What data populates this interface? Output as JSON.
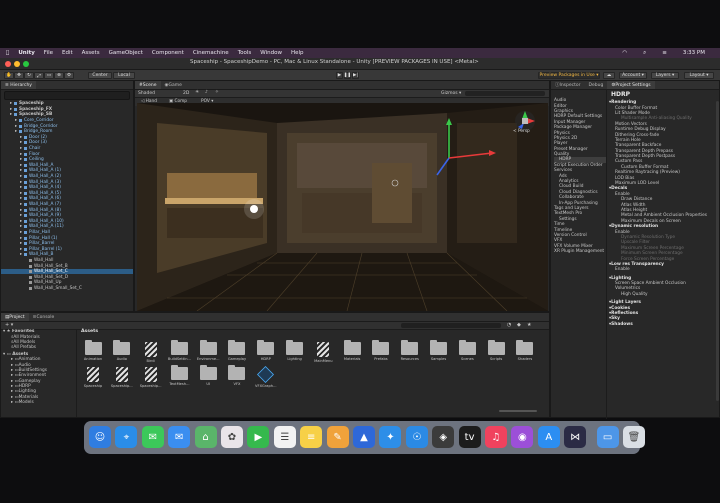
{
  "macMenu": {
    "items": [
      "Unity",
      "File",
      "Edit",
      "Assets",
      "GameObject",
      "Component",
      "Cinemachine",
      "Tools",
      "Window",
      "Help"
    ],
    "clock": "3:33 PM"
  },
  "window": {
    "title": "Spaceship - SpaceshipDemo - PC, Mac & Linux Standalone - Unity  [PREVIEW PACKAGES IN USE] <Metal>"
  },
  "toolbar": {
    "pivot_center": "Center",
    "pivot_local": "Local",
    "preview_packages": "Preview Packages in Use ▾",
    "account": "Account ▾",
    "layers": "Layers ▾",
    "layout": "Layout ▾"
  },
  "hierarchy": {
    "tab": "Hierarchy",
    "rows": [
      {
        "label": "Spaceship",
        "indent": 1,
        "kind": "scene"
      },
      {
        "label": "Spaceship_FX",
        "indent": 1,
        "kind": "scene"
      },
      {
        "label": "Spaceship_SB",
        "indent": 1,
        "kind": "scene"
      },
      {
        "label": "Core_Corridor",
        "indent": 2,
        "kind": "prefab"
      },
      {
        "label": "Bridge_Corridor",
        "indent": 2,
        "kind": "prefab"
      },
      {
        "label": "Bridge_Room",
        "indent": 2,
        "kind": "prefab"
      },
      {
        "label": "Door (2)",
        "indent": 3,
        "kind": "prefab"
      },
      {
        "label": "Door (3)",
        "indent": 3,
        "kind": "prefab"
      },
      {
        "label": "Chair",
        "indent": 3,
        "kind": "prefab"
      },
      {
        "label": "Floor",
        "indent": 3,
        "kind": "prefab"
      },
      {
        "label": "Ceiling",
        "indent": 3,
        "kind": "prefab"
      },
      {
        "label": "Wall_Hall_A",
        "indent": 3,
        "kind": "prefab"
      },
      {
        "label": "Wall_Hall_A (1)",
        "indent": 3,
        "kind": "prefab"
      },
      {
        "label": "Wall_Hall_A (2)",
        "indent": 3,
        "kind": "prefab"
      },
      {
        "label": "Wall_Hall_A (3)",
        "indent": 3,
        "kind": "prefab"
      },
      {
        "label": "Wall_Hall_A (4)",
        "indent": 3,
        "kind": "prefab"
      },
      {
        "label": "Wall_Hall_A (5)",
        "indent": 3,
        "kind": "prefab"
      },
      {
        "label": "Wall_Hall_A (6)",
        "indent": 3,
        "kind": "prefab"
      },
      {
        "label": "Wall_Hall_A (7)",
        "indent": 3,
        "kind": "prefab"
      },
      {
        "label": "Wall_Hall_A (8)",
        "indent": 3,
        "kind": "prefab"
      },
      {
        "label": "Wall_Hall_A (9)",
        "indent": 3,
        "kind": "prefab"
      },
      {
        "label": "Wall_Hall_A (10)",
        "indent": 3,
        "kind": "prefab"
      },
      {
        "label": "Wall_Hall_A (11)",
        "indent": 3,
        "kind": "prefab"
      },
      {
        "label": "Pillar_Hall",
        "indent": 3,
        "kind": "prefab"
      },
      {
        "label": "Pillar_Hall (1)",
        "indent": 3,
        "kind": "prefab"
      },
      {
        "label": "Pillar_Barrel",
        "indent": 3,
        "kind": "prefab"
      },
      {
        "label": "Pillar_Barrel (1)",
        "indent": 3,
        "kind": "prefab"
      },
      {
        "label": "Wall_Hall_B",
        "indent": 3,
        "kind": "prefab"
      },
      {
        "label": "Wall_Hall",
        "indent": 4,
        "kind": "object"
      },
      {
        "label": "Wall_Hall_Set_B",
        "indent": 4,
        "kind": "object"
      },
      {
        "label": "Wall_Hall_Set_C",
        "indent": 4,
        "kind": "object",
        "selected": true
      },
      {
        "label": "Wall_Hall_Set_D",
        "indent": 4,
        "kind": "object"
      },
      {
        "label": "Wall_Hall_Up",
        "indent": 4,
        "kind": "object"
      },
      {
        "label": "Wall_Hall_Small_Set_C",
        "indent": 4,
        "kind": "object"
      }
    ]
  },
  "scene": {
    "tabs": [
      "Scene",
      "Game"
    ],
    "shading": "Shaded",
    "mode_2d": "2D",
    "gizmos": "Gizmos ▾",
    "all_label": "All",
    "persp": "< Persp",
    "controls": [
      "Hand",
      "Comp",
      "POV"
    ]
  },
  "project": {
    "tabs": [
      "Project",
      "Console"
    ],
    "favorites_label": "Favorites",
    "favorites": [
      "All Materials",
      "All Models",
      "All Prefabs"
    ],
    "assets_label": "Assets",
    "tree": [
      "Animation",
      "Audio",
      "BuildSettings",
      "Environment",
      "Gameplay",
      "HDRP",
      "Lighting",
      "Materials",
      "Models"
    ],
    "header": "Assets",
    "items": [
      {
        "label": "Animation",
        "type": "folder"
      },
      {
        "label": "Audio",
        "type": "folder"
      },
      {
        "label": "Birdi",
        "type": "striped"
      },
      {
        "label": "BuildSettin...",
        "type": "folder"
      },
      {
        "label": "Environme...",
        "type": "folder"
      },
      {
        "label": "Gameplay",
        "type": "folder"
      },
      {
        "label": "HDRP",
        "type": "folder"
      },
      {
        "label": "Lighting",
        "type": "folder"
      },
      {
        "label": "MainMenu",
        "type": "striped"
      },
      {
        "label": "Materials",
        "type": "folder"
      },
      {
        "label": "Prefabs",
        "type": "folder"
      },
      {
        "label": "Resources",
        "type": "folder"
      },
      {
        "label": "Samples",
        "type": "folder"
      },
      {
        "label": "Scenes",
        "type": "folder"
      },
      {
        "label": "Scripts",
        "type": "folder"
      },
      {
        "label": "Shaders",
        "type": "folder"
      },
      {
        "label": "Spaceship",
        "type": "striped"
      },
      {
        "label": "Spaceship...",
        "type": "striped"
      },
      {
        "label": "Spaceship...",
        "type": "striped"
      },
      {
        "label": "TextMesh...",
        "type": "folder"
      },
      {
        "label": "UI",
        "type": "folder"
      },
      {
        "label": "VFX",
        "type": "folder"
      },
      {
        "label": "VFXGraph...",
        "type": "cube"
      }
    ]
  },
  "inspector": {
    "tabs": [
      "Inspector",
      "Debug"
    ]
  },
  "projectSettings": {
    "tab": "Project Settings",
    "left": [
      {
        "label": "Audio",
        "indent": 0
      },
      {
        "label": "Editor",
        "indent": 0
      },
      {
        "label": "Graphics",
        "indent": 0
      },
      {
        "label": "HDRP Default Settings",
        "indent": 0
      },
      {
        "label": "Input Manager",
        "indent": 0
      },
      {
        "label": "Package Manager",
        "indent": 0
      },
      {
        "label": "Physics",
        "indent": 0
      },
      {
        "label": "Physics 2D",
        "indent": 0
      },
      {
        "label": "Player",
        "indent": 0
      },
      {
        "label": "Preset Manager",
        "indent": 0
      },
      {
        "label": "Quality",
        "indent": 0
      },
      {
        "label": "HDRP",
        "indent": 1,
        "selected": true
      },
      {
        "label": "Script Execution Order",
        "indent": 0
      },
      {
        "label": "Services",
        "indent": 0
      },
      {
        "label": "Ads",
        "indent": 1
      },
      {
        "label": "Analytics",
        "indent": 1
      },
      {
        "label": "Cloud Build",
        "indent": 1
      },
      {
        "label": "Cloud Diagnostics",
        "indent": 1
      },
      {
        "label": "Collaborate",
        "indent": 1
      },
      {
        "label": "In-App Purchasing",
        "indent": 1
      },
      {
        "label": "Tags and Layers",
        "indent": 0
      },
      {
        "label": "TextMesh Pro",
        "indent": 0
      },
      {
        "label": "Settings",
        "indent": 1
      },
      {
        "label": "Time",
        "indent": 0
      },
      {
        "label": "Timeline",
        "indent": 0
      },
      {
        "label": "Version Control",
        "indent": 0
      },
      {
        "label": "VFX",
        "indent": 0
      },
      {
        "label": "VFX Volume Mixer",
        "indent": 0
      },
      {
        "label": "XR Plugin Management",
        "indent": 0
      }
    ],
    "heading": "HDRP",
    "right": [
      {
        "label": "Rendering",
        "style": "section"
      },
      {
        "label": "Color Buffer Format",
        "style": "item"
      },
      {
        "label": "Lit Shader Mode",
        "style": "item"
      },
      {
        "label": "Multisample Anti-aliasing Quality",
        "style": "dim"
      },
      {
        "label": "Motion Vectors",
        "style": "item"
      },
      {
        "label": "Runtime Debug Display",
        "style": "item"
      },
      {
        "label": "Dithering Cross-fade",
        "style": "item"
      },
      {
        "label": "Terrain Hole",
        "style": "item"
      },
      {
        "label": "Transparent Backface",
        "style": "item"
      },
      {
        "label": "Transparent Depth Prepass",
        "style": "item"
      },
      {
        "label": "Transparent Depth Postpass",
        "style": "item"
      },
      {
        "label": "Custom Pass",
        "style": "item"
      },
      {
        "label": "Custom Buffer Format",
        "style": "sub"
      },
      {
        "label": "Realtime Raytracing (Preview)",
        "style": "item"
      },
      {
        "label": "LOD Bias",
        "style": "item"
      },
      {
        "label": "Maximum LOD Level",
        "style": "item"
      },
      {
        "label": "Decals",
        "style": "section"
      },
      {
        "label": "Enable",
        "style": "item"
      },
      {
        "label": "Draw Distance",
        "style": "sub"
      },
      {
        "label": "Atlas Width",
        "style": "sub"
      },
      {
        "label": "Atlas Height",
        "style": "sub"
      },
      {
        "label": "Metal and Ambient Occlusion Properties",
        "style": "sub"
      },
      {
        "label": "Maximum Decals on Screen",
        "style": "sub"
      },
      {
        "label": "Dynamic resolution",
        "style": "section"
      },
      {
        "label": "Enable",
        "style": "item"
      },
      {
        "label": "Dynamic Resolution Type",
        "style": "dimsub"
      },
      {
        "label": "Upscale Filter",
        "style": "dimsub"
      },
      {
        "label": "Maximum Screen Percentage",
        "style": "dimsub"
      },
      {
        "label": "Minimum Screen Percentage",
        "style": "dimsub"
      },
      {
        "label": "Force Screen Percentage",
        "style": "dimsub"
      },
      {
        "label": "Low res Transparency",
        "style": "section"
      },
      {
        "label": "Enable",
        "style": "item"
      },
      {
        "label": "",
        "style": "gap"
      },
      {
        "label": "Lighting",
        "style": "section"
      },
      {
        "label": "Screen Space Ambient Occlusion",
        "style": "item"
      },
      {
        "label": "Volumetrics",
        "style": "item"
      },
      {
        "label": "High Quality",
        "style": "sub"
      },
      {
        "label": "",
        "style": "gap"
      },
      {
        "label": "Light Layers",
        "style": "section"
      },
      {
        "label": "Cookies",
        "style": "section"
      },
      {
        "label": "Reflections",
        "style": "section"
      },
      {
        "label": "Sky",
        "style": "section"
      },
      {
        "label": "Shadows",
        "style": "section"
      }
    ]
  },
  "dock": {
    "apps": [
      {
        "name": "finder",
        "color": "#2f7de1",
        "glyph": "☺"
      },
      {
        "name": "safari",
        "color": "#2a8de8",
        "glyph": "⌖"
      },
      {
        "name": "messages",
        "color": "#3cc85a",
        "glyph": "✉"
      },
      {
        "name": "mail",
        "color": "#3a8ef0",
        "glyph": "✉"
      },
      {
        "name": "maps",
        "color": "#5ab56a",
        "glyph": "⌂"
      },
      {
        "name": "photos",
        "color": "#e9e4e9",
        "glyph": "✿"
      },
      {
        "name": "facetime",
        "color": "#35b94d",
        "glyph": "▶"
      },
      {
        "name": "reminders",
        "color": "#f2f2f2",
        "glyph": "☰"
      },
      {
        "name": "notes",
        "color": "#f7d047",
        "glyph": "≡"
      },
      {
        "name": "pages",
        "color": "#f0a23b",
        "glyph": "✎"
      },
      {
        "name": "keynote",
        "color": "#2e68d8",
        "glyph": "▲"
      },
      {
        "name": "xcode",
        "color": "#2d8ee8",
        "glyph": "✦"
      },
      {
        "name": "accessibility",
        "color": "#2b8ae5",
        "glyph": "☉"
      },
      {
        "name": "unity-hub",
        "color": "#3b3b3b",
        "glyph": "◈"
      },
      {
        "name": "apple-tv",
        "color": "#1c1c1c",
        "glyph": "tv"
      },
      {
        "name": "music",
        "color": "#f0425e",
        "glyph": "♫"
      },
      {
        "name": "podcasts",
        "color": "#9c4fd8",
        "glyph": "◉"
      },
      {
        "name": "app-store",
        "color": "#2c8ef2",
        "glyph": "A"
      },
      {
        "name": "visual-studio",
        "color": "#2b2b45",
        "glyph": "⋈"
      },
      {
        "name": "downloads",
        "color": "#4d96e8",
        "glyph": "▭"
      },
      {
        "name": "trash",
        "color": "#d9dee4",
        "glyph": "🗑"
      }
    ]
  }
}
